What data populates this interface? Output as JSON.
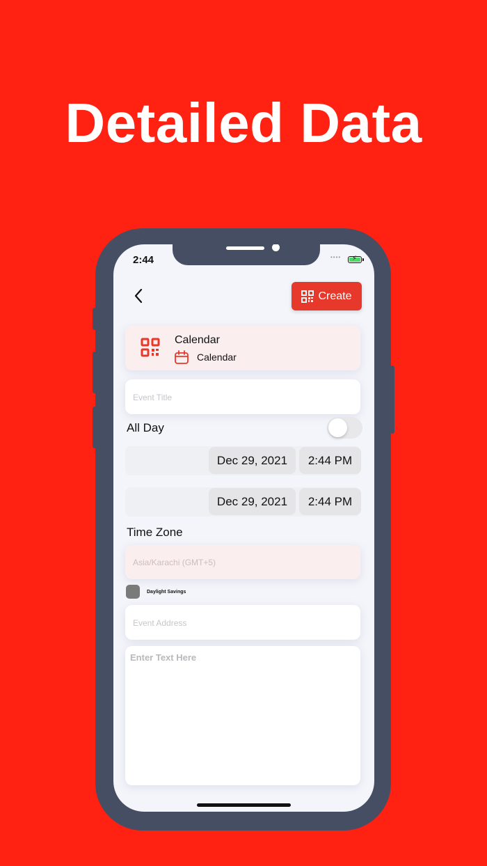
{
  "headline": "Detailed Data",
  "colors": {
    "background": "#ff2112",
    "accent": "#e7392b",
    "phone_frame": "#464e63"
  },
  "status_bar": {
    "time": "2:44",
    "signal": "••••",
    "battery": "charging"
  },
  "header": {
    "back_icon": "chevron-left-icon",
    "create_label": "Create",
    "create_icon": "qr-code-icon"
  },
  "code_type": {
    "title": "Calendar",
    "subtitle": "Calendar",
    "icon": "qr-code-icon",
    "sub_icon": "calendar-icon"
  },
  "form": {
    "event_title_placeholder": "Event Title",
    "all_day_label": "All Day",
    "all_day_on": false,
    "start": {
      "date": "Dec 29, 2021",
      "time": "2:44 PM"
    },
    "end": {
      "date": "Dec 29, 2021",
      "time": "2:44 PM"
    },
    "time_zone_label": "Time Zone",
    "time_zone_value": "Asia/Karachi (GMT+5)",
    "daylight_savings_label": "Daylight Savings",
    "event_address_placeholder": "Event Address",
    "notes_placeholder": "Enter Text Here"
  }
}
